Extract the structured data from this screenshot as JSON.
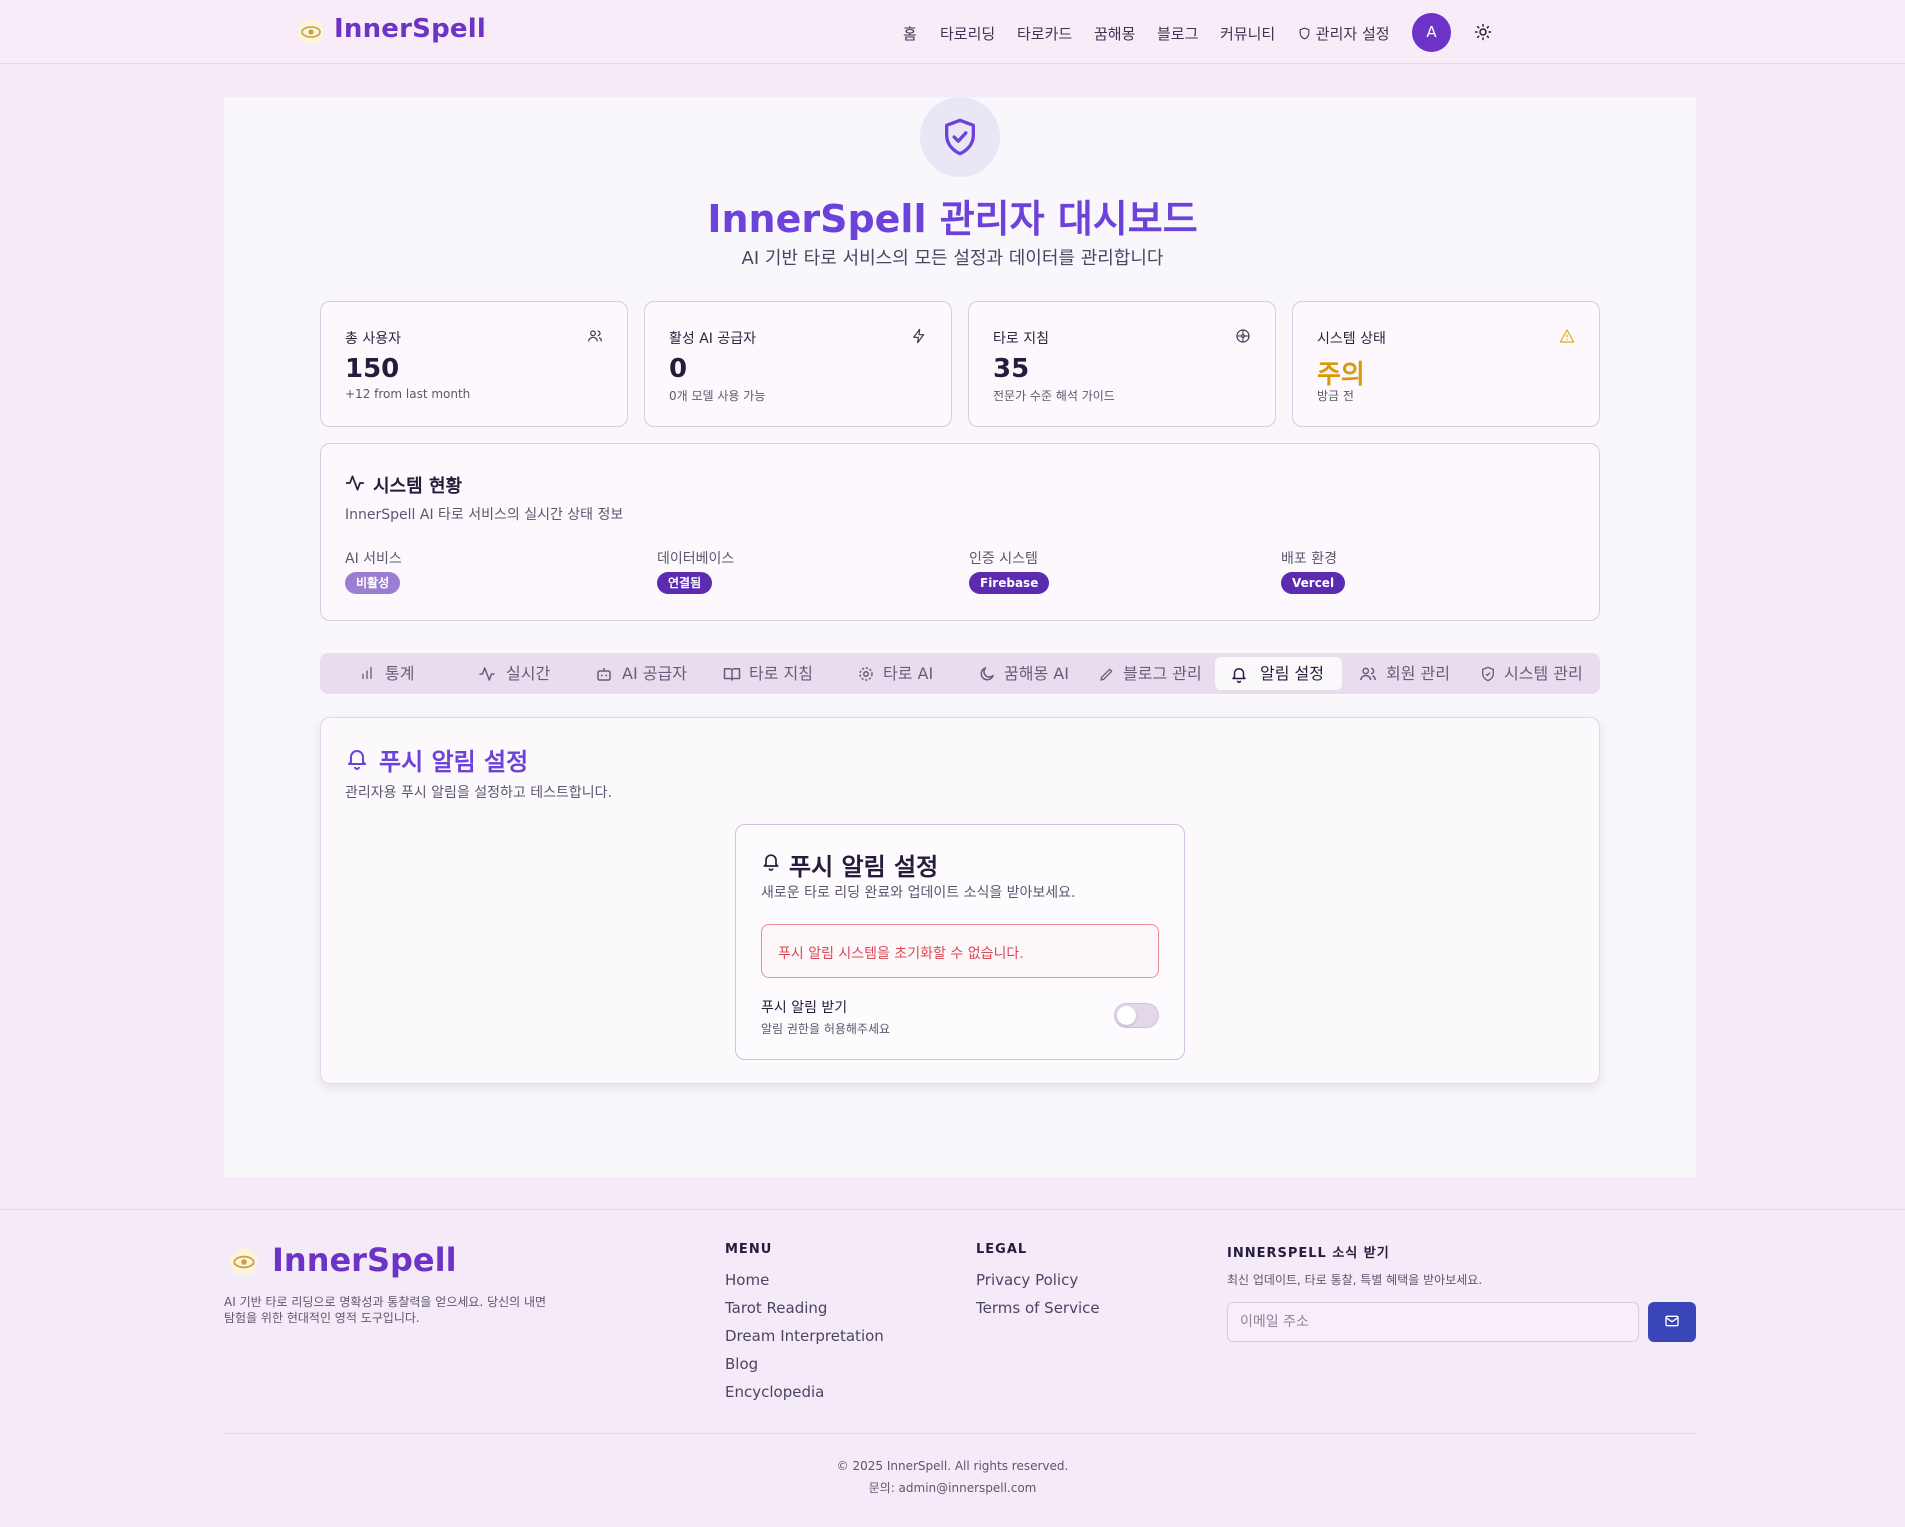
{
  "header": {
    "brand": "InnerSpell",
    "nav": [
      "홈",
      "타로리딩",
      "타로카드",
      "꿈해몽",
      "블로그",
      "커뮤니티",
      "관리자 설정"
    ],
    "avatar_initial": "A"
  },
  "hero": {
    "title": "InnerSpell 관리자 대시보드",
    "subtitle": "AI 기반 타로 서비스의 모든 설정과 데이터를 관리합니다"
  },
  "stats": [
    {
      "label": "총 사용자",
      "value": "150",
      "note": "+12 from last month",
      "icon": "users-icon"
    },
    {
      "label": "활성 AI 공급자",
      "value": "0",
      "note": "0개 모델 사용 가능",
      "icon": "zap-icon"
    },
    {
      "label": "타로 지침",
      "value": "35",
      "note": "전문가 수준 해석 가이드",
      "icon": "dharma-wheel-icon"
    },
    {
      "label": "시스템 상태",
      "value": "주의",
      "note": "방금 전",
      "icon": "warning-icon",
      "value_color": "#d89a06"
    }
  ],
  "system_status": {
    "title": "시스템 현황",
    "description": "InnerSpell AI 타로 서비스의 실시간 상태 정보",
    "items": [
      {
        "name": "AI 서비스",
        "status": "비활성"
      },
      {
        "name": "데이터베이스",
        "status": "연결됨"
      },
      {
        "name": "인증 시스템",
        "status": "Firebase"
      },
      {
        "name": "배포 환경",
        "status": "Vercel"
      }
    ]
  },
  "tabs": [
    "통계",
    "실시간",
    "AI 공급자",
    "타로 지침",
    "타로 AI",
    "꿈해몽 AI",
    "블로그 관리",
    "알림 설정",
    "회원 관리",
    "시스템 관리"
  ],
  "active_tab": "알림 설정",
  "push_section": {
    "title": "푸시 알림 설정",
    "description": "관리자용 푸시 알림을 설정하고 테스트합니다.",
    "card": {
      "title": "푸시 알림 설정",
      "description": "새로운 타로 리딩 완료와 업데이트 소식을 받아보세요.",
      "error": "푸시 알림 시스템을 초기화할 수 없습니다.",
      "toggle_label": "푸시 알림 받기",
      "toggle_hint": "알림 권한을 허용해주세요",
      "toggle_on": false
    }
  },
  "footer": {
    "brand": "InnerSpell",
    "description": "AI 기반 타로 리딩으로 명확성과 통찰력을 얻으세요. 당신의 내면 탐험을 위한 현대적인 영적 도구입니다.",
    "menu_heading": "MENU",
    "menu": [
      "Home",
      "Tarot Reading",
      "Dream Interpretation",
      "Blog",
      "Encyclopedia"
    ],
    "legal_heading": "LEGAL",
    "legal": [
      "Privacy Policy",
      "Terms of Service"
    ],
    "newsletter_heading": "INNERSPELL 소식 받기",
    "newsletter_desc": "최신 업데이트, 타로 통찰, 특별 혜택을 받아보세요.",
    "email_placeholder": "이메일 주소",
    "copyright": "© 2025 InnerSpell. All rights reserved.",
    "contact": "문의: admin@innerspell.com"
  },
  "colors": {
    "brand": "#6d33c6",
    "accent": "#6d42db",
    "warning": "#d89a06",
    "error": "#d84a57",
    "send_button": "#3a45b8"
  }
}
